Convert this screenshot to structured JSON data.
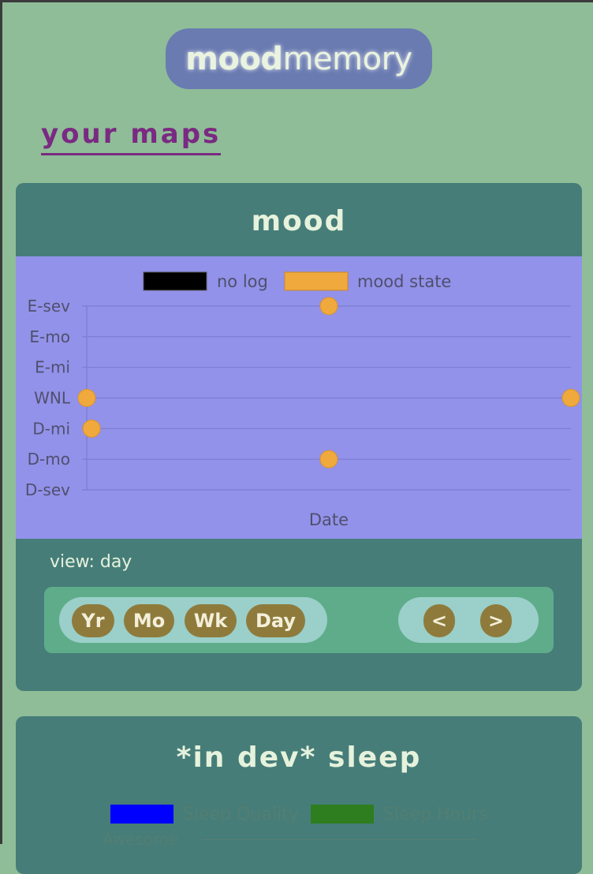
{
  "logo": {
    "bold": "mood",
    "light": "memory"
  },
  "page_heading": "your maps",
  "mood_card": {
    "title": "mood",
    "view_label": "view: day",
    "range_buttons": [
      "Yr",
      "Mo",
      "Wk",
      "Day"
    ],
    "nav_buttons": {
      "prev": "<",
      "next": ">"
    }
  },
  "sleep_card": {
    "title": "*in dev* sleep",
    "legend": [
      "Sleep Quality",
      "Sleep Hours"
    ],
    "axis_label": "Awesome"
  },
  "colors": {
    "background": "#8fbd97",
    "card": "#467d79",
    "chart_bg": "#9292ea",
    "mood_point": "#f0a93c",
    "no_log": "#000000",
    "sleep_quality": "#0000ff",
    "sleep_hours": "#2e7d1f",
    "accent_heading": "#7a2a82"
  },
  "chart_data": {
    "type": "scatter",
    "title": "",
    "xlabel": "Date",
    "ylabel": "",
    "legend": [
      "no log",
      "mood state"
    ],
    "y_categories": [
      "D-sev",
      "D-mo",
      "D-mi",
      "WNL",
      "E-mi",
      "E-mo",
      "E-sev"
    ],
    "series": [
      {
        "name": "mood state",
        "points": [
          {
            "x": 0.0,
            "y": "WNL"
          },
          {
            "x": 0.01,
            "y": "D-mi"
          },
          {
            "x": 0.5,
            "y": "E-sev"
          },
          {
            "x": 0.5,
            "y": "D-mo"
          },
          {
            "x": 1.0,
            "y": "WNL"
          }
        ]
      }
    ],
    "grid": true,
    "legend_position": "top"
  }
}
